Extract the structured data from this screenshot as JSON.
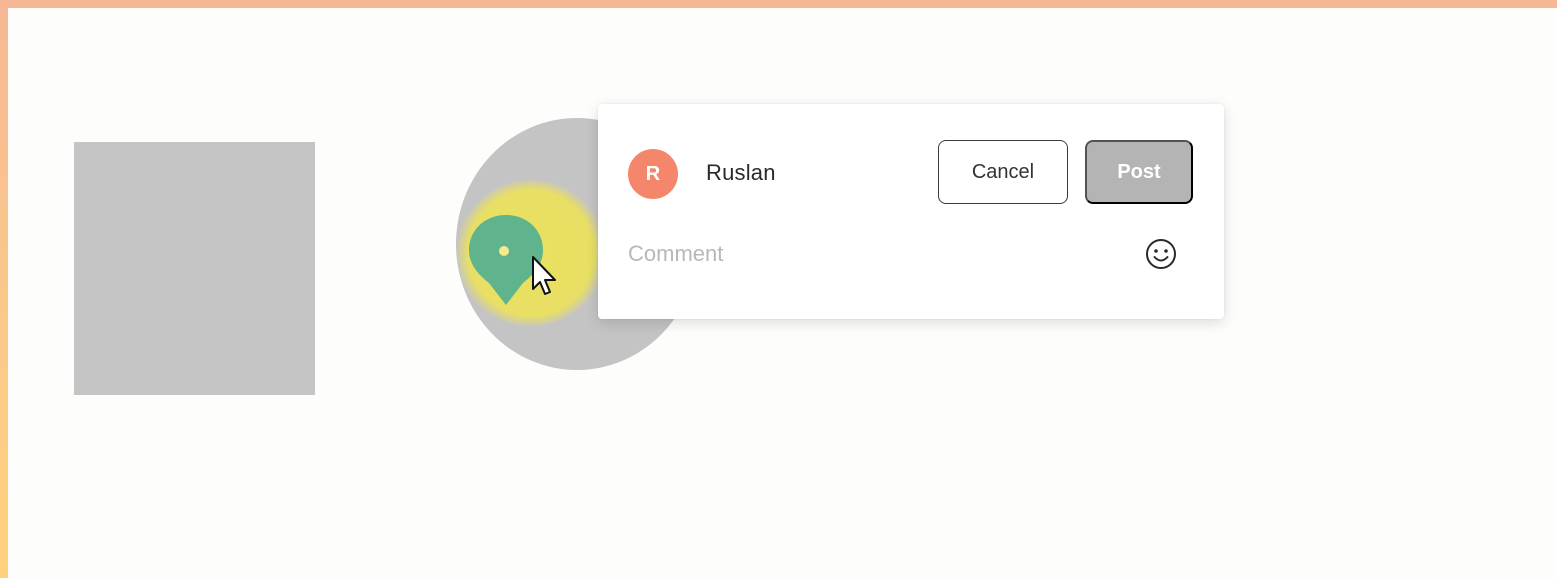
{
  "canvas": {
    "shapes": [
      {
        "name": "square",
        "fill": "#c5c5c5"
      },
      {
        "name": "circle",
        "fill": "#c4c4c4"
      }
    ],
    "highlight_color": "#ece25a",
    "pin": {
      "icon": "map-pin-icon",
      "color": "#5fb48e"
    },
    "cursor": {
      "icon": "arrow-cursor-icon"
    }
  },
  "comment_popover": {
    "user": {
      "initial": "R",
      "name": "Ruslan",
      "avatar_color": "#f4876b"
    },
    "cancel_label": "Cancel",
    "post_label": "Post",
    "comment": {
      "placeholder": "Comment",
      "value": ""
    },
    "emoji_icon": "smiley-icon"
  },
  "colors": {
    "frame_top": "#f6b894",
    "frame_bottom": "#fed27d",
    "post_disabled": "#b4b4b4"
  }
}
